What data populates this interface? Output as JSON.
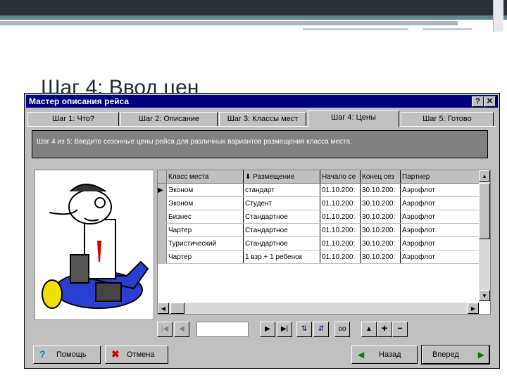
{
  "slide": {
    "title": "Шаг 4: Ввод цен"
  },
  "window": {
    "title": "Мастер описания рейса",
    "help_btn": "?",
    "close_btn": "✕"
  },
  "tabs": [
    {
      "label": "Шаг 1: Что?"
    },
    {
      "label": "Шаг 2: Описание"
    },
    {
      "label": "Шаг 3: Классы мест"
    },
    {
      "label": "Шаг 4: Цены"
    },
    {
      "label": "Шаг 5: Готово"
    }
  ],
  "instructions": "Шаг 4 из 5: Введите сезонные цены рейса для различных вариантов размещения класса места.",
  "grid": {
    "columns": [
      "Класс места",
      "⬇ Размещение",
      "Начало се",
      "Конец сез",
      "Партнер"
    ],
    "rows": [
      [
        "Эконом",
        "стандарт",
        "01.10.200:",
        "30.10.200:",
        "Аэрофлот"
      ],
      [
        "Эконом",
        "Студент",
        "01.10.200:",
        "30.10.200:",
        "Аэрофлот"
      ],
      [
        "Бизнес",
        "Стандартное",
        "01.10.200:",
        "30.10.200:",
        "Аэрофлот"
      ],
      [
        "Чартер",
        "Стандартное",
        "01.10.200:",
        "30.10.200:",
        "Аэрофлот"
      ],
      [
        "Туристический",
        "Стандартное",
        "01.10.200:",
        "30.10.200:",
        "Аэрофлот"
      ],
      [
        "Чартер",
        "1 взр + 1 ребенок",
        "01.10.200:",
        "30.10.200:",
        "Аэрофлот"
      ]
    ]
  },
  "buttons": {
    "help": "Помощь",
    "cancel": "Отмена",
    "back": "Назад",
    "next": "Вперед"
  }
}
